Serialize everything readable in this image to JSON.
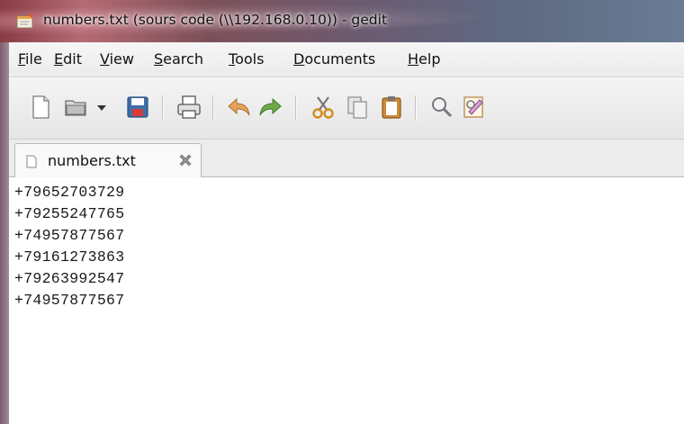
{
  "window": {
    "title": "numbers.txt (sours code (\\\\192.168.0.10)) - gedit"
  },
  "menu": {
    "items": [
      {
        "mnemonic": "F",
        "rest": "ile"
      },
      {
        "mnemonic": "E",
        "rest": "dit"
      },
      {
        "mnemonic": "V",
        "rest": "iew"
      },
      {
        "mnemonic": "S",
        "rest": "earch"
      },
      {
        "mnemonic": "T",
        "rest": "ools"
      },
      {
        "mnemonic": "D",
        "rest": "ocuments"
      },
      {
        "mnemonic": "H",
        "rest": "elp"
      }
    ]
  },
  "toolbar": {
    "icons": [
      "new-document-icon",
      "open-folder-icon",
      "dropdown-arrow-icon",
      "save-icon",
      "print-icon",
      "undo-icon",
      "redo-icon",
      "cut-icon",
      "copy-icon",
      "paste-icon",
      "find-icon",
      "find-replace-icon"
    ]
  },
  "tab": {
    "label": "numbers.txt",
    "close_icon": "close-icon"
  },
  "editor": {
    "lines": [
      "+79652703729",
      "+79255247765",
      "+74957877567",
      "+79161273863",
      "+79263992547",
      "+74957877567"
    ]
  }
}
